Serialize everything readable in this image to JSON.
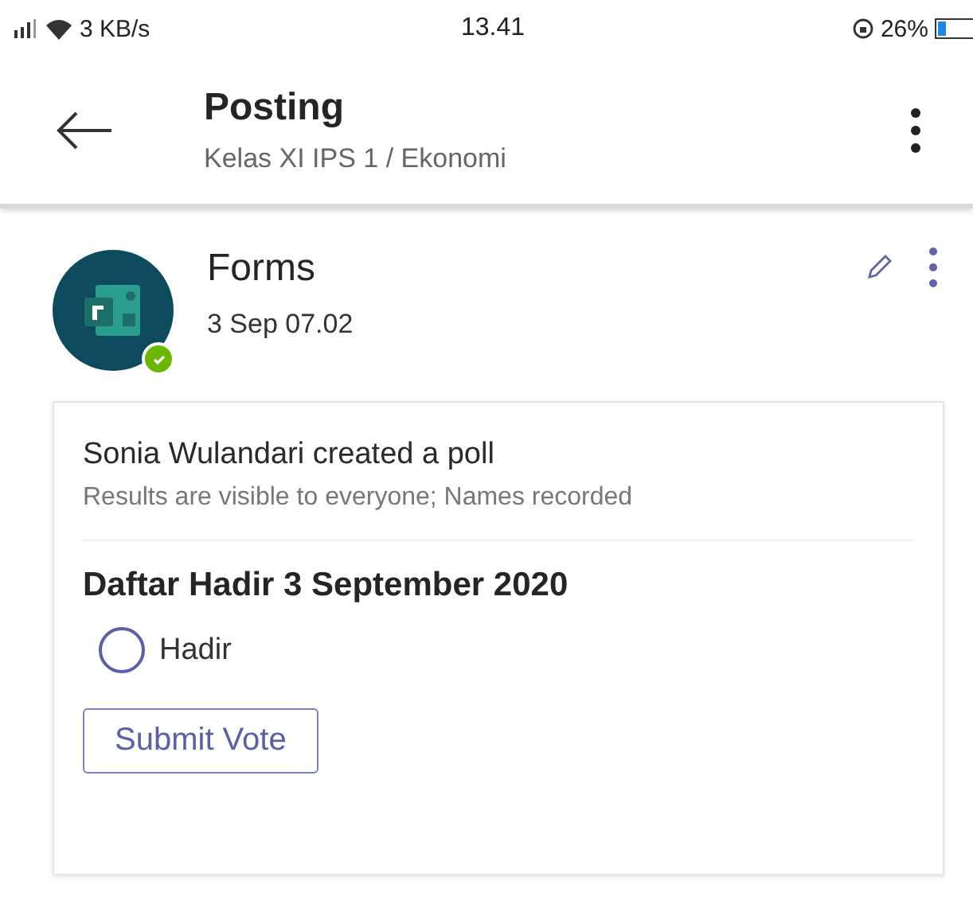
{
  "status_bar": {
    "speed": "3 KB/s",
    "time": "13.41",
    "battery": "26%"
  },
  "header": {
    "title": "Posting",
    "subtitle": "Kelas XI IPS 1 / Ekonomi"
  },
  "post": {
    "author": "Forms",
    "online": true,
    "timestamp": "3 Sep 07.02",
    "poll": {
      "creator_line": "Sonia Wulandari created a poll",
      "info": "Results are visible to everyone; Names recorded",
      "question": "Daftar Hadir 3 September 2020",
      "options": [
        {
          "label": "Hadir",
          "selected": false
        }
      ],
      "submit": "Submit Vote"
    }
  }
}
